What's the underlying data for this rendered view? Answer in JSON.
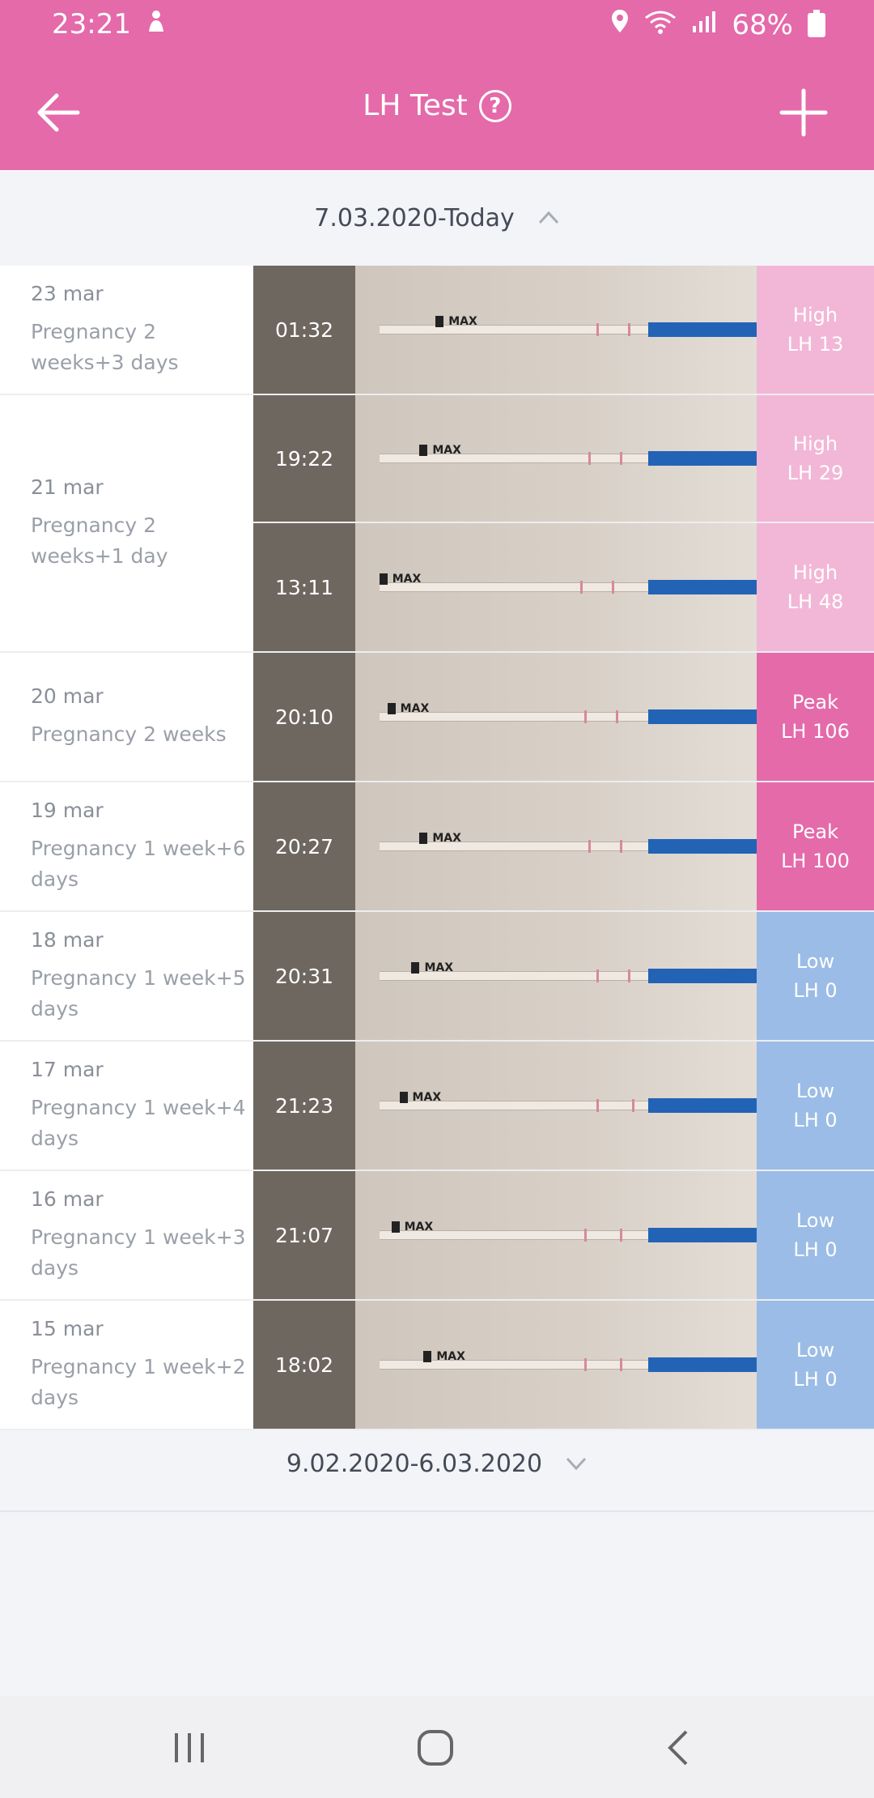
{
  "status_bar": {
    "time": "23:21",
    "battery": "68%",
    "icons": [
      "notification-icon",
      "location-icon",
      "wifi-icon",
      "signal-icon",
      "battery-icon"
    ]
  },
  "app_bar": {
    "title": "LH Test",
    "help_symbol": "?",
    "back_icon": "arrow-left-icon",
    "add_icon": "plus-icon"
  },
  "ranges": {
    "current": "7.03.2020-Today",
    "previous": "9.02.2020-6.03.2020"
  },
  "groups": [
    {
      "date": "23 mar",
      "stage": "Pregnancy 2 weeks+3 days",
      "entries": [
        {
          "time": "01:32",
          "level": "High",
          "value": "LH 13",
          "kind": "high"
        }
      ]
    },
    {
      "date": "21 mar",
      "stage": "Pregnancy 2 weeks+1 day",
      "entries": [
        {
          "time": "19:22",
          "level": "High",
          "value": "LH 29",
          "kind": "high"
        },
        {
          "time": "13:11",
          "level": "High",
          "value": "LH 48",
          "kind": "high"
        }
      ]
    },
    {
      "date": "20 mar",
      "stage": "Pregnancy 2 weeks",
      "entries": [
        {
          "time": "20:10",
          "level": "Peak",
          "value": "LH 106",
          "kind": "peak"
        }
      ]
    },
    {
      "date": "19 mar",
      "stage": "Pregnancy 1 week+6 days",
      "entries": [
        {
          "time": "20:27",
          "level": "Peak",
          "value": "LH 100",
          "kind": "peak"
        }
      ]
    },
    {
      "date": "18 mar",
      "stage": "Pregnancy 1 week+5 days",
      "entries": [
        {
          "time": "20:31",
          "level": "Low",
          "value": "LH 0",
          "kind": "low"
        }
      ]
    },
    {
      "date": "17 mar",
      "stage": "Pregnancy 1 week+4 days",
      "entries": [
        {
          "time": "21:23",
          "level": "Low",
          "value": "LH 0",
          "kind": "low"
        }
      ]
    },
    {
      "date": "16 mar",
      "stage": "Pregnancy 1 week+3 days",
      "entries": [
        {
          "time": "21:07",
          "level": "Low",
          "value": "LH 0",
          "kind": "low"
        }
      ]
    },
    {
      "date": "15 mar",
      "stage": "Pregnancy 1 week+2 days",
      "entries": [
        {
          "time": "18:02",
          "level": "Low",
          "value": "LH 0",
          "kind": "low"
        }
      ]
    }
  ],
  "strip_label": "MAX",
  "colors": {
    "brand": "#e46aaa",
    "high": "#f2b7d6",
    "peak": "#e46aaa",
    "low": "#9bbce6"
  },
  "nav": {
    "icons": [
      "recent-apps-icon",
      "home-icon",
      "back-icon"
    ]
  }
}
